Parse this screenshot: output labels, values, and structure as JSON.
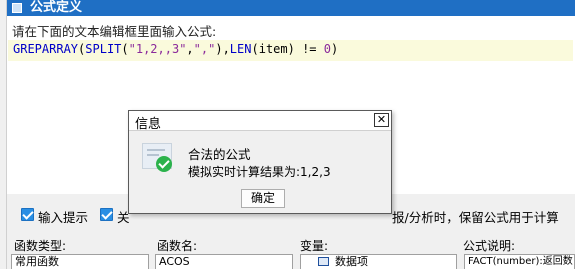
{
  "window": {
    "title": "公式定义"
  },
  "instruction": "请在下面的文本编辑框里面输入公式:",
  "formula": {
    "tokens": [
      {
        "t": "GREPARRAY",
        "c": "k-fn"
      },
      {
        "t": "(",
        "c": "k-p"
      },
      {
        "t": "SPLIT",
        "c": "k-fn"
      },
      {
        "t": "(",
        "c": "k-p"
      },
      {
        "t": "\"1,2,,3\"",
        "c": "k-s"
      },
      {
        "t": ",",
        "c": "k-p"
      },
      {
        "t": "\",\"",
        "c": "k-s"
      },
      {
        "t": "),",
        "c": "k-p"
      },
      {
        "t": "LEN",
        "c": "k-fn"
      },
      {
        "t": "(",
        "c": "k-p"
      },
      {
        "t": "item",
        "c": "k-id"
      },
      {
        "t": ") != ",
        "c": "k-p"
      },
      {
        "t": "0",
        "c": "k-s"
      },
      {
        "t": ")",
        "c": "k-p"
      }
    ]
  },
  "options": {
    "input_hint_label": "输入提示",
    "second_label_fragment": "关",
    "right_text_fragment": "报/分析时，保留公式用于计算"
  },
  "panels": {
    "function_type": {
      "header": "函数类型:",
      "first_item": "常用函数"
    },
    "function_name": {
      "header": "函数名:",
      "first_item": "ACOS"
    },
    "variable": {
      "header": "变量:",
      "first_item": "数据项"
    },
    "description": {
      "header": "公式说明:",
      "first_item": "FACT(number):返回数"
    }
  },
  "dialog": {
    "title": "信息",
    "close_glyph": "✕",
    "message_title": "合法的公式",
    "message_result": "模拟实时计算结果为:1,2,3",
    "ok_label": "确定"
  },
  "colors": {
    "titlebar": "#1f6fc4",
    "editor_line_highlight": "#fafadc",
    "function_keyword": "#0000c8",
    "string_literal": "#8b2b9b",
    "success_check": "#2bb24c"
  }
}
